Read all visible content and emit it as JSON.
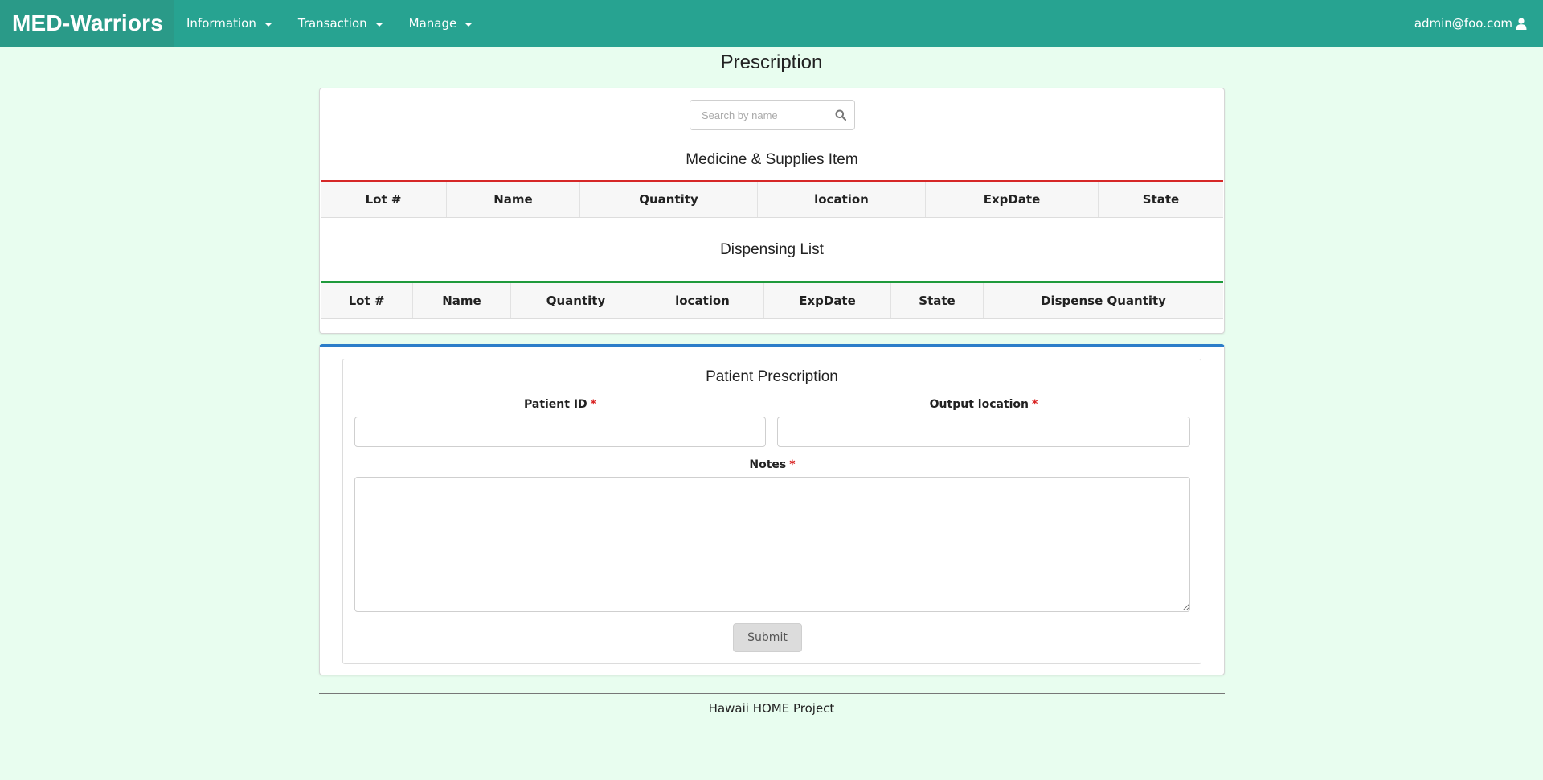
{
  "navbar": {
    "brand": "MED-Warriors",
    "menus": [
      {
        "label": "Information"
      },
      {
        "label": "Transaction"
      },
      {
        "label": "Manage"
      }
    ],
    "user": "admin@foo.com",
    "bg_color": "#27a391"
  },
  "page": {
    "title": "Prescription"
  },
  "search": {
    "placeholder": "Search by name",
    "value": ""
  },
  "medicine_table": {
    "title": "Medicine & Supplies Item",
    "accent": "#d62828",
    "columns": [
      "Lot #",
      "Name",
      "Quantity",
      "location",
      "ExpDate",
      "State"
    ],
    "rows": []
  },
  "dispensing_table": {
    "title": "Dispensing List",
    "accent": "#1f9a3c",
    "columns": [
      "Lot #",
      "Name",
      "Quantity",
      "location",
      "ExpDate",
      "State",
      "Dispense Quantity"
    ],
    "rows": []
  },
  "form": {
    "title": "Patient Prescription",
    "patient_id_label": "Patient ID",
    "patient_id_value": "",
    "output_location_label": "Output location",
    "output_location_value": "",
    "notes_label": "Notes",
    "notes_value": "",
    "required_mark": "*",
    "submit_label": "Submit",
    "accent": "#2c7dc9"
  },
  "footer": {
    "text": "Hawaii HOME Project"
  }
}
